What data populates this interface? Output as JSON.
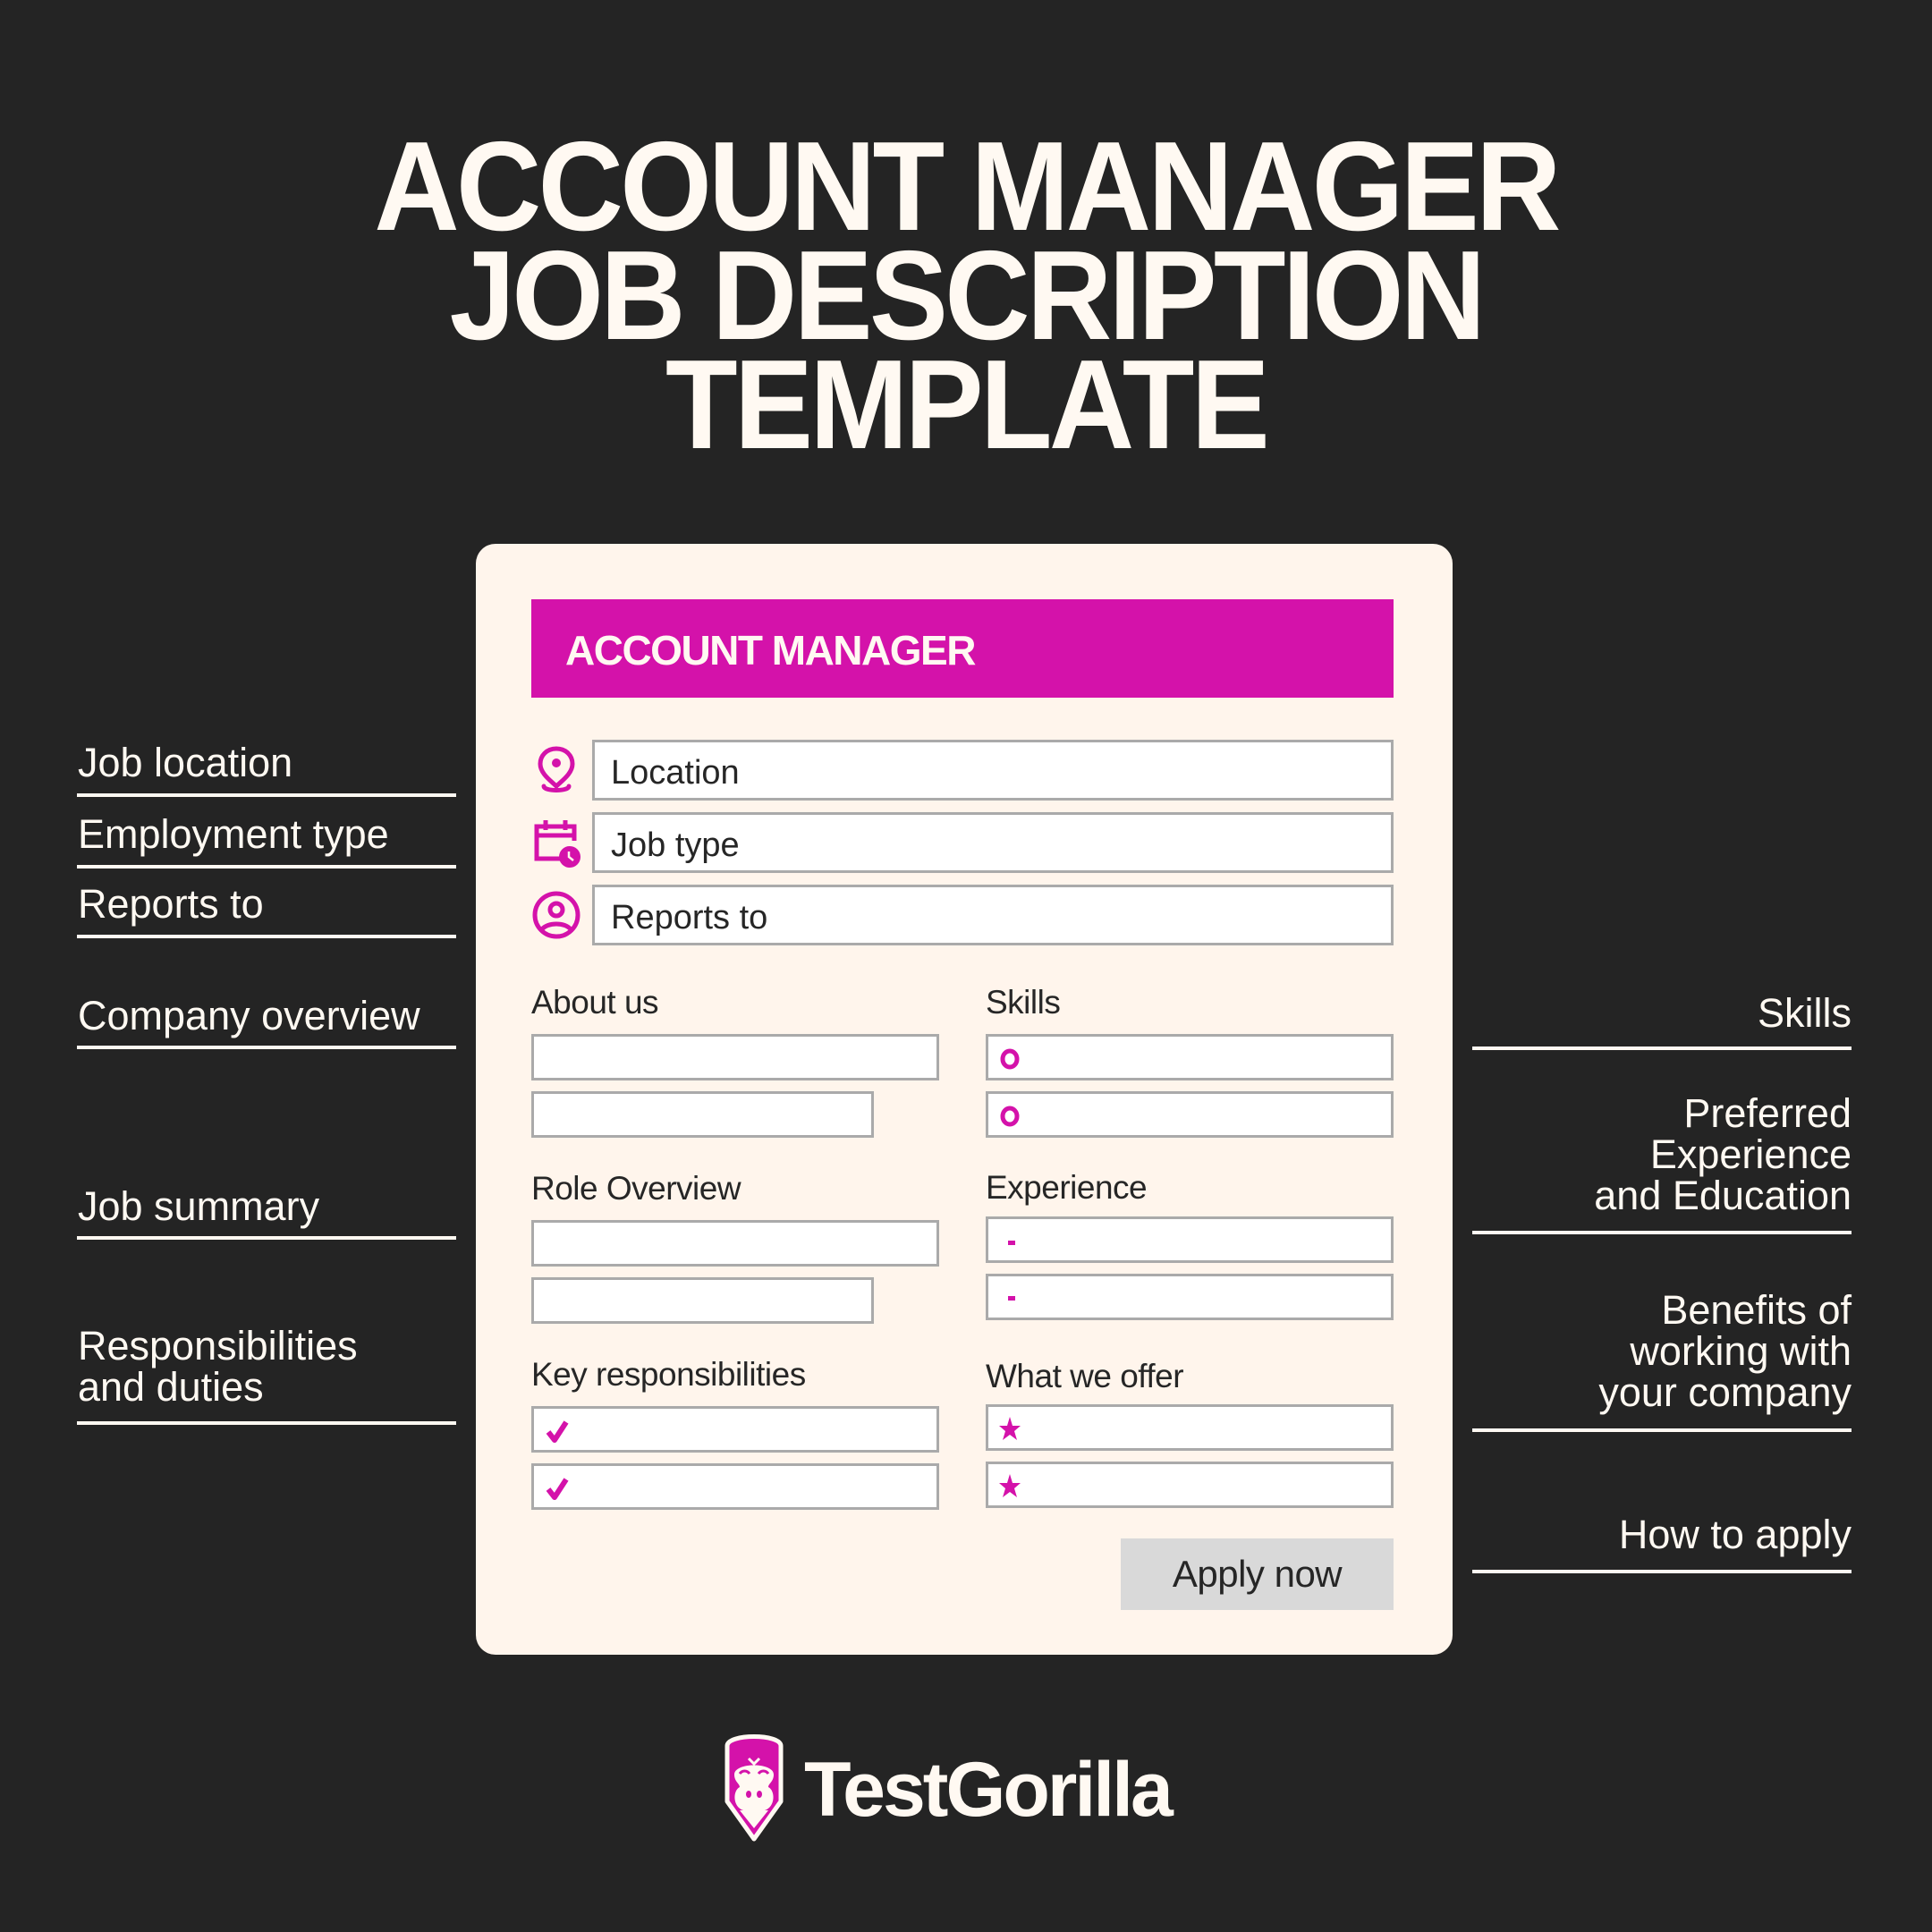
{
  "title": {
    "lines": [
      "ACCOUNT MANAGER",
      "JOB DESCRIPTION",
      "TEMPLATE"
    ]
  },
  "colors": {
    "background": "#242424",
    "card": "#FFF5EC",
    "accent": "#D412AA",
    "text_light": "#FFF9F2",
    "text_dark": "#262626",
    "field_border": "#AAAAAA",
    "button_bg": "#D9D9D9"
  },
  "card": {
    "banner_title": "ACCOUNT MANAGER",
    "info_fields": [
      {
        "icon": "location-pin-icon",
        "value": "Location"
      },
      {
        "icon": "calendar-clock-icon",
        "value": "Job type"
      },
      {
        "icon": "user-circle-icon",
        "value": "Reports to"
      }
    ],
    "sections": {
      "about_us": {
        "label": "About us",
        "rows": 2,
        "bullet": "none"
      },
      "skills": {
        "label": "Skills",
        "rows": 2,
        "bullet": "ring-bullet-icon"
      },
      "role_overview": {
        "label": "Role Overview",
        "rows": 2,
        "bullet": "none"
      },
      "experience": {
        "label": "Experience",
        "rows": 2,
        "bullet": "dash-bullet-icon"
      },
      "key_responsibilities": {
        "label": "Key responsibilities",
        "rows": 2,
        "bullet": "checkmark-icon"
      },
      "what_we_offer": {
        "label": "What we offer",
        "rows": 2,
        "bullet": "star-icon"
      }
    },
    "apply_button": "Apply now"
  },
  "left_annotations": [
    "Job location",
    "Employment type",
    "Reports to",
    "Company overview",
    "Job summary",
    "Responsibilities\nand duties"
  ],
  "right_annotations": [
    "Skills",
    "Preferred\nExperience\nand Education",
    "Benefits of\nworking with\nyour company",
    "How to apply"
  ],
  "brand": {
    "name": "TestGorilla",
    "logo_icon": "gorilla-logo-icon"
  }
}
